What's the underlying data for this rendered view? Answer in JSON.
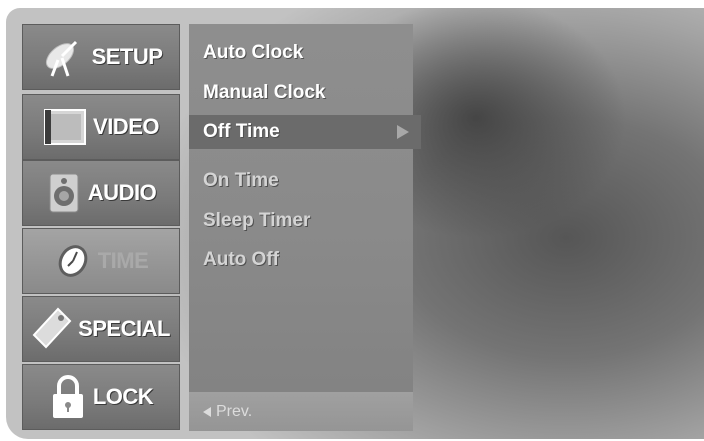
{
  "main_menu": {
    "items": [
      {
        "label": "SETUP",
        "icon": "satellite-dish-icon"
      },
      {
        "label": "VIDEO",
        "icon": "screen-icon"
      },
      {
        "label": "AUDIO",
        "icon": "speaker-icon"
      },
      {
        "label": "TIME",
        "icon": "clock-icon"
      },
      {
        "label": "SPECIAL",
        "icon": "tag-icon"
      },
      {
        "label": "LOCK",
        "icon": "padlock-icon"
      }
    ]
  },
  "time_submenu": {
    "items": [
      {
        "label": "Auto Clock"
      },
      {
        "label": "Manual Clock"
      },
      {
        "label": "Off Time"
      },
      {
        "label": "On Time"
      },
      {
        "label": "Sleep Timer"
      },
      {
        "label": "Auto Off"
      }
    ],
    "selected_label": "Off Time",
    "prev_label": "Prev."
  }
}
